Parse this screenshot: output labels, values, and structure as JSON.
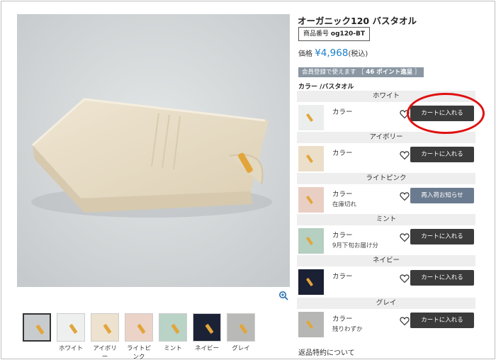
{
  "product": {
    "title": "オーガニック120 バスタオル",
    "sku_label": "商品番号",
    "sku": "og120-BT",
    "price_label": "価格",
    "price": "¥4,968",
    "tax_note": "(税込)",
    "points_text": "会員登録で使えます ［",
    "points_value": "46 ポイント進呈",
    "points_close": "］",
    "color_heading": "カラー /バスタオル",
    "returns_link": "返品特約について"
  },
  "thumbs": [
    {
      "label": "",
      "bg": "#c9ccce"
    },
    {
      "label": "ホワイト",
      "bg": "#eef0f0"
    },
    {
      "label": "アイボリー",
      "bg": "#ece2cf"
    },
    {
      "label": "ライトピンク",
      "bg": "#ecd3c8"
    },
    {
      "label": "ミント",
      "bg": "#b9d3c6"
    },
    {
      "label": "ネイビー",
      "bg": "#1c2236"
    },
    {
      "label": "グレイ",
      "bg": "#b9bab8"
    }
  ],
  "variants": [
    {
      "name": "ホワイト",
      "label": "カラー",
      "status": "",
      "button": "カートに入れる",
      "bg": "#eceeee"
    },
    {
      "name": "アイボリー",
      "label": "カラー",
      "status": "",
      "button": "カートに入れる",
      "bg": "#ebdfca"
    },
    {
      "name": "ライトピンク",
      "label": "カラー",
      "status": "在庫切れ",
      "button": "再入荷お知らせ",
      "bg": "#e9cfc3"
    },
    {
      "name": "ミント",
      "label": "カラー",
      "status": "9月下旬お届け分",
      "button": "カートに入れる",
      "bg": "#b5cfc1"
    },
    {
      "name": "ネイビー",
      "label": "カラー",
      "status": "",
      "button": "カートに入れる",
      "bg": "#1b2134"
    },
    {
      "name": "グレイ",
      "label": "カラー",
      "status": "残りわずか",
      "button": "カートに入れる",
      "bg": "#b6b7b5"
    }
  ],
  "colors": {
    "accent_price": "#1a7fc9",
    "button_dark": "#3b3b3b",
    "button_notify": "#6b7b8f",
    "highlight": "#e01010",
    "tag": "#e2a53a"
  }
}
